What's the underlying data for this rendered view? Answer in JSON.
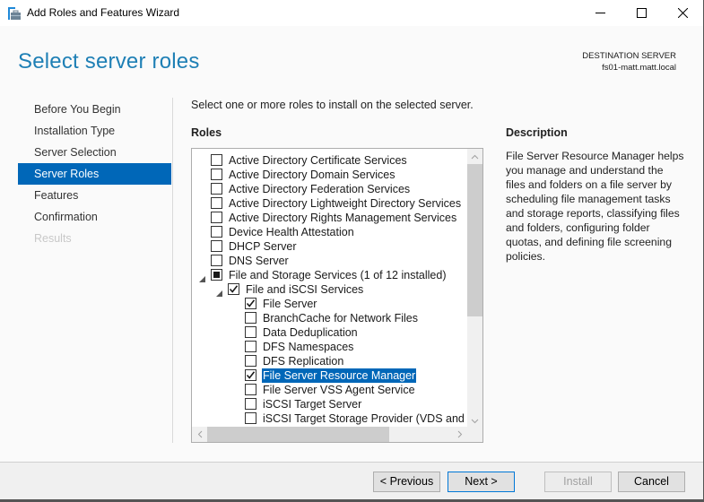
{
  "window": {
    "title": "Add Roles and Features Wizard",
    "icon": "server-manager-icon",
    "controls": [
      "minimize-icon",
      "maximize-icon",
      "close-icon"
    ]
  },
  "header": {
    "page_title": "Select server roles",
    "destination_label": "DESTINATION SERVER",
    "destination_server": "fs01-matt.matt.local"
  },
  "nav": {
    "items": [
      {
        "label": "Before You Begin",
        "state": "normal"
      },
      {
        "label": "Installation Type",
        "state": "normal"
      },
      {
        "label": "Server Selection",
        "state": "normal"
      },
      {
        "label": "Server Roles",
        "state": "active"
      },
      {
        "label": "Features",
        "state": "normal"
      },
      {
        "label": "Confirmation",
        "state": "normal"
      },
      {
        "label": "Results",
        "state": "disabled"
      }
    ]
  },
  "main": {
    "intro": "Select one or more roles to install on the selected server.",
    "roles_label": "Roles",
    "roles": [
      {
        "label": "Active Directory Certificate Services",
        "level": 0,
        "state": "unchecked",
        "expander": "none"
      },
      {
        "label": "Active Directory Domain Services",
        "level": 0,
        "state": "unchecked",
        "expander": "none"
      },
      {
        "label": "Active Directory Federation Services",
        "level": 0,
        "state": "unchecked",
        "expander": "none"
      },
      {
        "label": "Active Directory Lightweight Directory Services",
        "level": 0,
        "state": "unchecked",
        "expander": "none"
      },
      {
        "label": "Active Directory Rights Management Services",
        "level": 0,
        "state": "unchecked",
        "expander": "none"
      },
      {
        "label": "Device Health Attestation",
        "level": 0,
        "state": "unchecked",
        "expander": "none"
      },
      {
        "label": "DHCP Server",
        "level": 0,
        "state": "unchecked",
        "expander": "none"
      },
      {
        "label": "DNS Server",
        "level": 0,
        "state": "unchecked",
        "expander": "none"
      },
      {
        "label": "File and Storage Services (1 of 12 installed)",
        "level": 0,
        "state": "indeterminate",
        "expander": "expanded"
      },
      {
        "label": "File and iSCSI Services",
        "level": 1,
        "state": "checked",
        "expander": "expanded"
      },
      {
        "label": "File Server",
        "level": 2,
        "state": "checked",
        "expander": "none"
      },
      {
        "label": "BranchCache for Network Files",
        "level": 2,
        "state": "unchecked",
        "expander": "none"
      },
      {
        "label": "Data Deduplication",
        "level": 2,
        "state": "unchecked",
        "expander": "none"
      },
      {
        "label": "DFS Namespaces",
        "level": 2,
        "state": "unchecked",
        "expander": "none"
      },
      {
        "label": "DFS Replication",
        "level": 2,
        "state": "unchecked",
        "expander": "none"
      },
      {
        "label": "File Server Resource Manager",
        "level": 2,
        "state": "checked",
        "expander": "none",
        "selected": true
      },
      {
        "label": "File Server VSS Agent Service",
        "level": 2,
        "state": "unchecked",
        "expander": "none"
      },
      {
        "label": "iSCSI Target Server",
        "level": 2,
        "state": "unchecked",
        "expander": "none"
      },
      {
        "label": "iSCSI Target Storage Provider (VDS and VSS hardware providers)",
        "level": 2,
        "state": "unchecked",
        "expander": "none"
      }
    ],
    "description_label": "Description",
    "description": "File Server Resource Manager helps you manage and understand the files and folders on a file server by scheduling file management tasks and storage reports, classifying files and folders, configuring folder quotas, and defining file screening policies."
  },
  "footer": {
    "previous": "< Previous",
    "next": "Next >",
    "install": "Install",
    "cancel": "Cancel"
  },
  "colors": {
    "accent": "#0067b8",
    "title": "#1e7fb5"
  }
}
